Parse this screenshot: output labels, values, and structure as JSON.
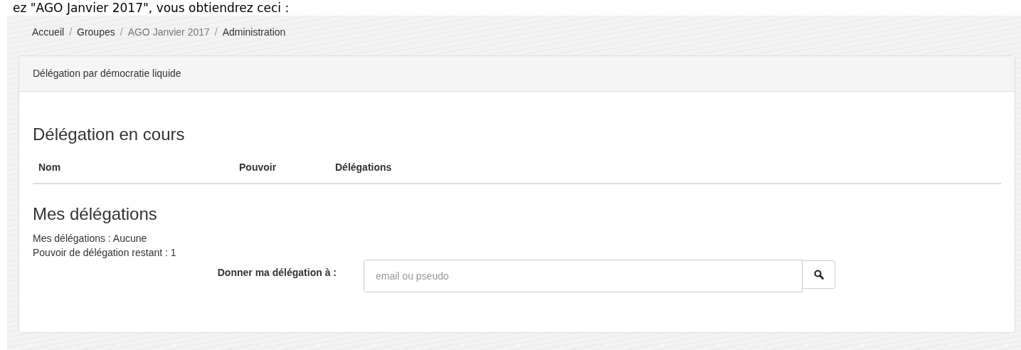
{
  "caption": "ez \"AGO Janvier 2017\", vous obtiendrez ceci :",
  "breadcrumb": [
    {
      "label": "Accueil",
      "selected": false
    },
    {
      "separator": "/",
      "label": "Groupes",
      "selected": false
    },
    {
      "separator": "/",
      "label": "AGO Janvier 2017",
      "selected": true
    },
    {
      "separator": "/",
      "label": "Administration",
      "selected": false
    }
  ],
  "panel": {
    "title": "Délégation par démocratie liquide",
    "current": {
      "heading": "Délégation en cours",
      "columns": [
        "Nom",
        "Pouvoir",
        "Délégations"
      ]
    },
    "mine": {
      "heading": "Mes délégations",
      "lines": [
        "Mes délégations : Aucune",
        "Pouvoir de délégation restant : 1"
      ],
      "form": {
        "label": "Donner ma délégation à :",
        "placeholder": "email ou pseudo"
      }
    }
  }
}
